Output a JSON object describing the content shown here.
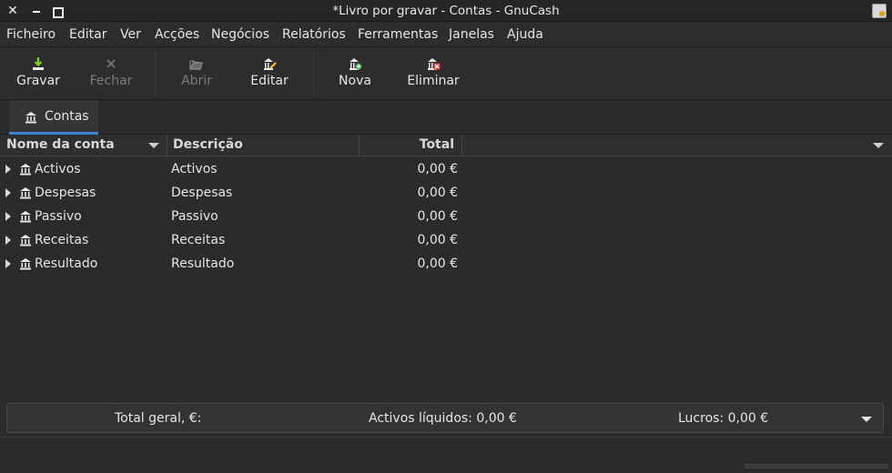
{
  "window": {
    "title": "*Livro por gravar - Contas - GnuCash",
    "controls": [
      "close-icon",
      "minimize-icon",
      "maximize-icon"
    ]
  },
  "menubar": {
    "items": [
      "Ficheiro",
      "Editar",
      "Ver",
      "Acções",
      "Negócios",
      "Relatórios",
      "Ferramentas",
      "Janelas",
      "Ajuda"
    ]
  },
  "toolbar": {
    "buttons": [
      {
        "label": "Gravar",
        "icon": "save-icon",
        "enabled": true
      },
      {
        "label": "Fechar",
        "icon": "close-icon",
        "enabled": false
      },
      {
        "label": "Abrir",
        "icon": "open-account-icon",
        "enabled": false
      },
      {
        "label": "Editar",
        "icon": "edit-account-icon",
        "enabled": true
      },
      {
        "label": "Nova",
        "icon": "new-account-icon",
        "enabled": true
      },
      {
        "label": "Eliminar",
        "icon": "delete-account-icon",
        "enabled": true
      }
    ]
  },
  "tabs": [
    {
      "label": "Contas",
      "icon": "accounts-icon",
      "active": true
    }
  ],
  "accounts_tree": {
    "columns": [
      "Nome da conta",
      "Descrição",
      "Total"
    ],
    "rows": [
      {
        "name": "Activos",
        "description": "Activos",
        "total": "0,00 €"
      },
      {
        "name": "Despesas",
        "description": "Despesas",
        "total": "0,00 €"
      },
      {
        "name": "Passivo",
        "description": "Passivo",
        "total": "0,00 €"
      },
      {
        "name": "Receitas",
        "description": "Receitas",
        "total": "0,00 €"
      },
      {
        "name": "Resultado",
        "description": "Resultado",
        "total": "0,00 €"
      }
    ]
  },
  "summary": {
    "total_label": "Total geral, €:",
    "net_assets": "Activos líquidos: 0,00 €",
    "profits": "Lucros: 0,00 €"
  },
  "colors": {
    "accent": "#3b82d6",
    "background": "#2b2b2b",
    "text": "#e6e6e6",
    "disabled_text": "#7b7b7b"
  }
}
